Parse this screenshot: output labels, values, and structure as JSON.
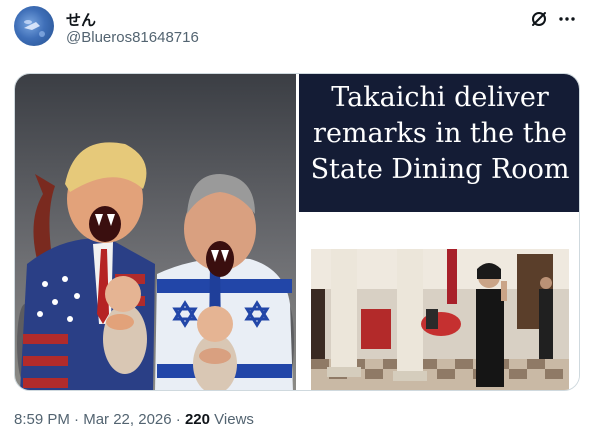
{
  "post": {
    "author_name": "せん",
    "author_handle": "@Blueros81648716",
    "time": "8:59 PM",
    "separator": "·",
    "date": "Mar 22, 2026",
    "views_count": "220",
    "views_label": "Views"
  },
  "media": {
    "right_headline": "Takaichi deliver remarks in the the State Dining Room"
  },
  "icons": {
    "grok": "grok-icon",
    "more": "more-icon"
  },
  "colors": {
    "text_primary": "#0f1419",
    "text_secondary": "#536471",
    "headline_bg": "#141c35",
    "border": "#cfd9de"
  }
}
